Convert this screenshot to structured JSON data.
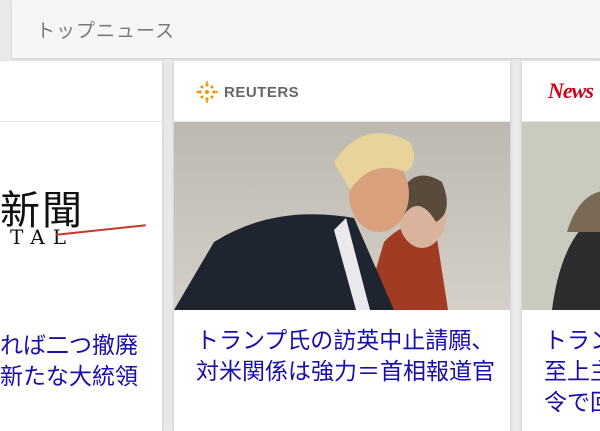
{
  "section": {
    "title": "トップニュース"
  },
  "cards": [
    {
      "source": "",
      "logo_text": "新聞",
      "logo_subtext": "TAL",
      "headline": "れば二つ撤廃\n新たな大統領"
    },
    {
      "source": "REUTERS",
      "headline": "トランプ氏の訪英中止請願、対米関係は強力＝首相報道官"
    },
    {
      "source": "News",
      "headline": "トラン\n至上主\n令で回"
    }
  ],
  "colors": {
    "headline": "#1a0dab",
    "reuters": "#f29100",
    "news_brand": "#d2001a"
  }
}
